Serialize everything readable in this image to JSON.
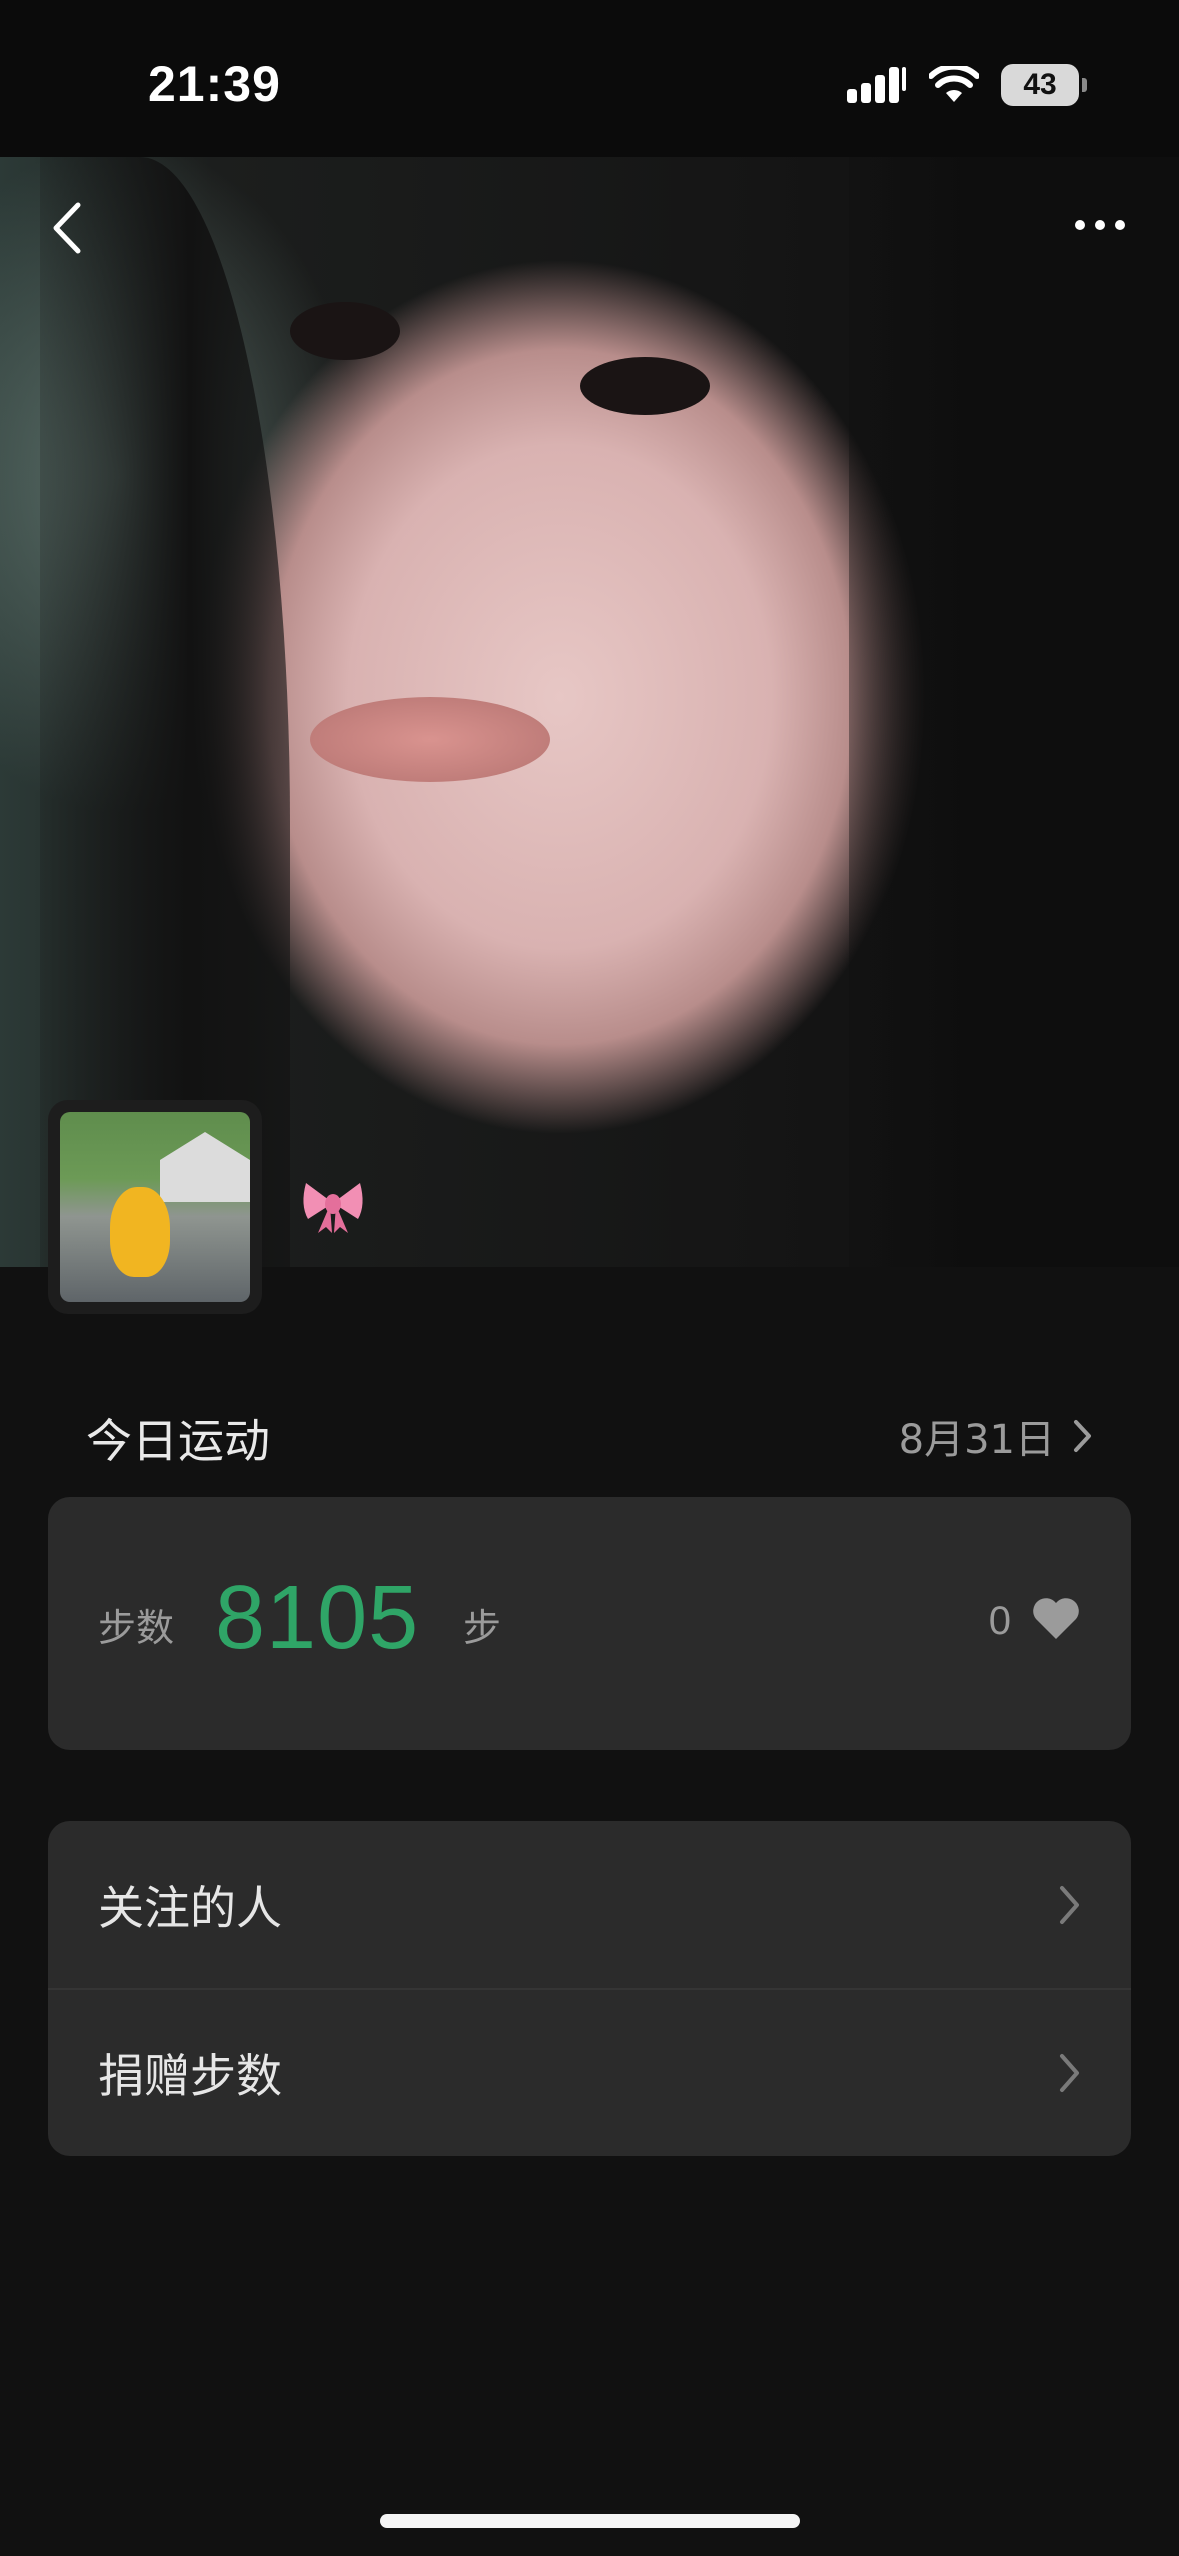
{
  "status_bar": {
    "time": "21:39",
    "battery": "43"
  },
  "profile": {
    "bow_icon": "pink-bow-emoji"
  },
  "today": {
    "title": "今日运动",
    "date": "8月31日"
  },
  "steps": {
    "label": "步数",
    "value": "8105",
    "unit": "步",
    "likes": "0"
  },
  "menu": {
    "items": [
      {
        "label": "关注的人"
      },
      {
        "label": "捐赠步数"
      }
    ]
  },
  "colors": {
    "accent_green": "#2fa567",
    "card_bg": "#2b2b2b",
    "page_bg": "#111111"
  }
}
